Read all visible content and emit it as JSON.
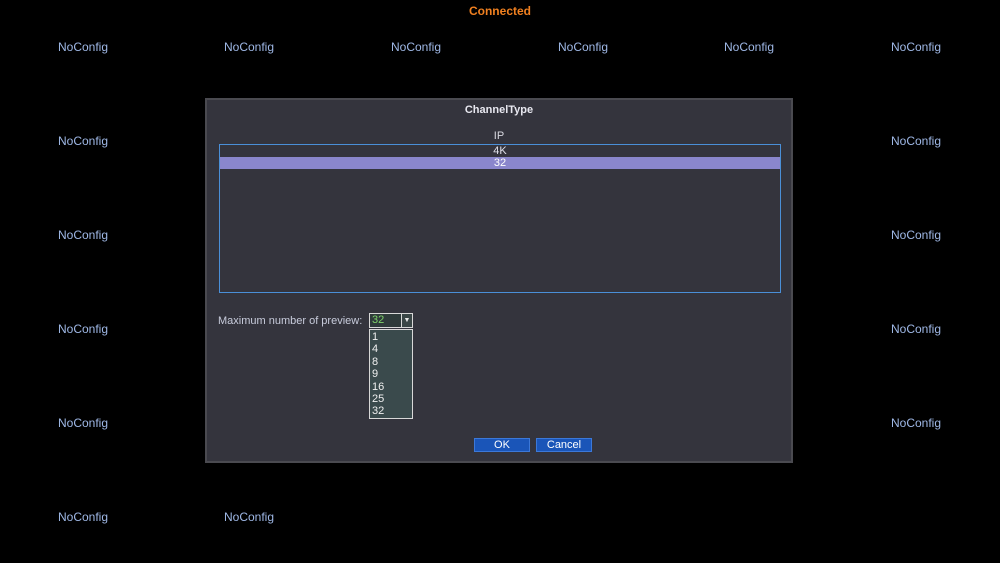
{
  "status": {
    "text": "Connected",
    "color": "#f08020"
  },
  "channel_grid": {
    "placeholder_label": "NoConfig",
    "cells": [
      "NoConfig",
      "NoConfig",
      "NoConfig",
      "NoConfig",
      "NoConfig",
      "NoConfig",
      "NoConfig",
      "NoConfig",
      "NoConfig",
      "NoConfig",
      "NoConfig",
      "NoConfig",
      "NoConfig",
      "NoConfig",
      "NoConfig",
      "NoConfig"
    ]
  },
  "dialog": {
    "title": "ChannelType",
    "list_header": "IP",
    "list_rows": [
      {
        "label": "4K",
        "selected": false
      },
      {
        "label": "32",
        "selected": true
      }
    ],
    "preview_label": "Maximum number of preview:",
    "preview_select": {
      "value": "32",
      "options": [
        "1",
        "4",
        "8",
        "9",
        "16",
        "25",
        "32"
      ]
    },
    "ok_label": "OK",
    "cancel_label": "Cancel"
  },
  "colors": {
    "background": "#000000",
    "dialog_bg": "#34343d",
    "selection": "#8a86cc",
    "button": "#1a55b8",
    "cell_text": "#9fb8e6",
    "select_value": "#7fd36a"
  }
}
